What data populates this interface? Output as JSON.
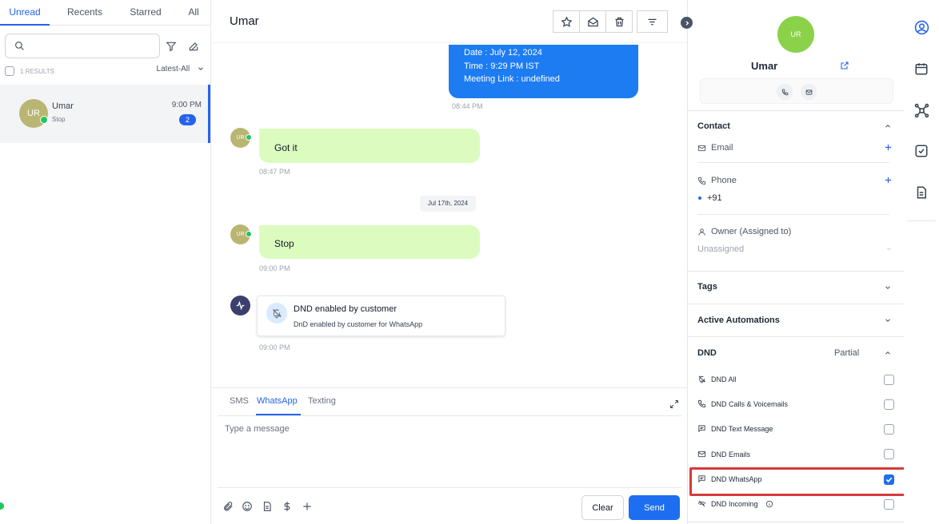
{
  "left_panel": {
    "tabs": [
      "Unread",
      "Recents",
      "Starred",
      "All"
    ],
    "search": {
      "placeholder": ""
    },
    "results_label": "1 RESULTS",
    "sort": "Latest-All",
    "conversation": {
      "avatar": "UR",
      "name": "Umar",
      "preview": "Stop",
      "time": "9:00 PM",
      "unread_count": "2",
      "channel_icon": "whatsapp-icon"
    }
  },
  "thread": {
    "title": "Umar",
    "header_icons": [
      "star-icon",
      "mail-open-icon",
      "trash-icon",
      "filter-icon"
    ],
    "outgoing_lines": [
      "Date : July 12, 2024",
      "Time : 9:29 PM IST",
      "Meeting Link : undefined"
    ],
    "outgoing_time": "08:44 PM",
    "msg1": {
      "avatar": "UR",
      "text": "Got it",
      "time": "08:47 PM"
    },
    "date_divider": "Jul 17th, 2024",
    "msg2": {
      "avatar": "UR",
      "text": "Stop",
      "time": "09:00 PM"
    },
    "dnd_event": {
      "title": "DND enabled by customer",
      "subtitle": "DnD enabled by customer for WhatsApp",
      "time": "09:00 PM"
    }
  },
  "composer": {
    "tabs": [
      "SMS",
      "WhatsApp",
      "Texting"
    ],
    "active_tab": "WhatsApp",
    "placeholder": "Type a message",
    "tool_icons": [
      "paperclip-icon",
      "emoji-icon",
      "document-icon",
      "dollar-icon",
      "plus-icon"
    ],
    "clear_label": "Clear",
    "send_label": "Send"
  },
  "contact": {
    "avatar": "UR",
    "name": "Umar",
    "sections": {
      "contact": "Contact",
      "email_label": "Email",
      "phone_label": "Phone",
      "phone_value": "+91",
      "owner_label": "Owner (Assigned to)",
      "owner_value": "Unassigned",
      "tags": "Tags",
      "automations": "Active Automations",
      "dnd": "DND",
      "dnd_status": "Partial"
    },
    "dnd_items": [
      {
        "label": "DND All",
        "checked": false
      },
      {
        "label": "DND Calls & Voicemails",
        "checked": false
      },
      {
        "label": "DND Text Message",
        "checked": false
      },
      {
        "label": "DND Emails",
        "checked": false
      },
      {
        "label": "DND WhatsApp",
        "checked": true
      },
      {
        "label": "DND Incoming",
        "checked": false
      }
    ]
  },
  "rail_icons": [
    "contact-icon",
    "calendar-icon",
    "network-icon",
    "task-icon",
    "notes-icon"
  ],
  "colors": {
    "accent": "#2563eb",
    "incoming_bubble": "#dcfcbf",
    "outgoing_bubble": "#1d7cf2",
    "highlight": "#d63a3a"
  }
}
